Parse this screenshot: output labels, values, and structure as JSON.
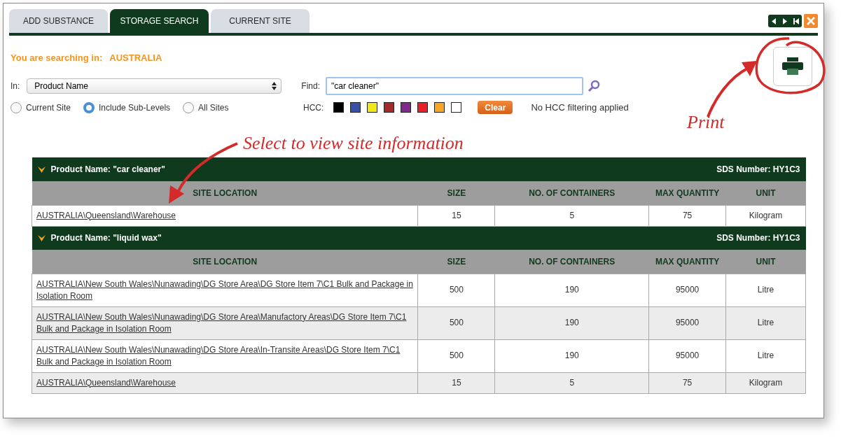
{
  "tabs": [
    {
      "label": "ADD SUBSTANCE",
      "selected": false
    },
    {
      "label": "STORAGE SEARCH",
      "selected": true
    },
    {
      "label": "CURRENT SITE",
      "selected": false
    }
  ],
  "scope": {
    "label": "You are searching in:",
    "value": "AUSTRALIA"
  },
  "in_field": {
    "label": "In:",
    "value": "Product Name"
  },
  "find_field": {
    "label": "Find:",
    "value": "\"car cleaner\""
  },
  "radios": [
    {
      "label": "Current Site",
      "selected": false
    },
    {
      "label": "Include Sub-Levels",
      "selected": true
    },
    {
      "label": "All Sites",
      "selected": false
    }
  ],
  "hcc": {
    "label": "HCC:",
    "swatches": [
      {
        "color": "#000000"
      },
      {
        "color": "#3a4fa8"
      },
      {
        "color": "#f0e618"
      },
      {
        "color": "#a52a2a"
      },
      {
        "color": "#7f2b8c"
      },
      {
        "color": "#e8202a"
      },
      {
        "color": "#f5a623"
      },
      {
        "color": "#ffffff"
      }
    ],
    "clear_button": "Clear",
    "status": "No HCC filtering applied"
  },
  "annotations": [
    {
      "text": "Select to view site information"
    },
    {
      "text": "Print"
    }
  ],
  "groups": [
    {
      "title": "Product Name: \"car cleaner\"",
      "sds": "SDS Number: HY1C3",
      "columns": [
        "SITE LOCATION",
        "SIZE",
        "NO. OF CONTAINERS",
        "MAX QUANTITY",
        "UNIT"
      ],
      "rows": [
        {
          "location": "AUSTRALIA\\Queensland\\Warehouse",
          "size": "15",
          "containers": "5",
          "max": "75",
          "unit": "Kilogram"
        }
      ]
    },
    {
      "title": "Product Name: \"liquid wax\"",
      "sds": "SDS Number: HY1C3",
      "columns": [
        "SITE LOCATION",
        "SIZE",
        "NO. OF CONTAINERS",
        "MAX QUANTITY",
        "UNIT"
      ],
      "rows": [
        {
          "location": "AUSTRALIA\\New South Wales\\Nunawading\\DG Store Area\\DG Store Item 7\\C1 Bulk and Package in Isolation Room",
          "size": "500",
          "containers": "190",
          "max": "95000",
          "unit": "Litre"
        },
        {
          "location": "AUSTRALIA\\New South Wales\\Nunawading\\DG Store Area\\Manufactory Areas\\DG Store Item 7\\C1 Bulk and Package in Isolation Room",
          "size": "500",
          "containers": "190",
          "max": "95000",
          "unit": "Litre"
        },
        {
          "location": "AUSTRALIA\\New South Wales\\Nunawading\\DG Store Area\\In-Transite Areas\\DG Store Item 7\\C1 Bulk and Package in Isolation Room",
          "size": "500",
          "containers": "190",
          "max": "95000",
          "unit": "Litre"
        },
        {
          "location": "AUSTRALIA\\Queensland\\Warehouse",
          "size": "15",
          "containers": "5",
          "max": "75",
          "unit": "Kilogram"
        }
      ]
    }
  ]
}
